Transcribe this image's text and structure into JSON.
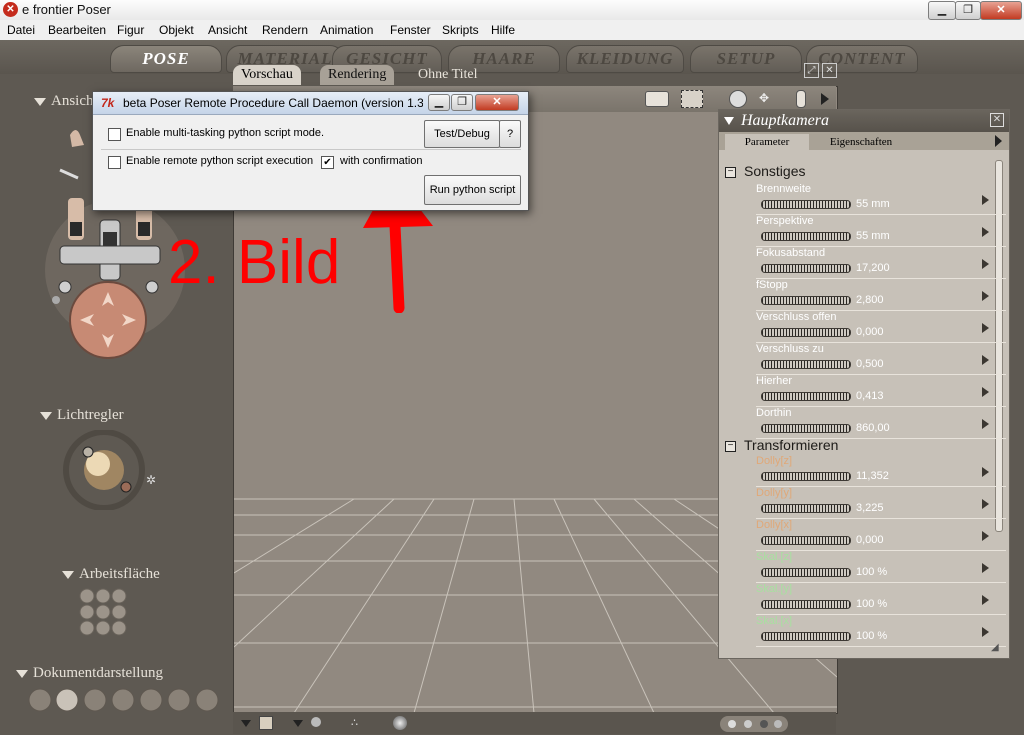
{
  "window": {
    "title": "e frontier Poser",
    "app_icon": "poser-logo-icon"
  },
  "menubar": {
    "items": [
      "Datei",
      "Bearbeiten",
      "Figur",
      "Objekt",
      "Ansicht",
      "Rendern",
      "Animation",
      "Fenster",
      "Skripts",
      "Hilfe"
    ]
  },
  "room_tabs": [
    "POSE",
    "MATERIAL",
    "GESICHT",
    "HAARE",
    "KLEIDUNG",
    "SETUP",
    "CONTENT"
  ],
  "left_panel": {
    "ansicht_label": "Ansicht",
    "lichtregler_label": "Lichtregler",
    "arbeitsflaeche_label": "Arbeitsfläche",
    "dokumentdarstellung_label": "Dokumentdarstellung"
  },
  "viewport": {
    "tabs": [
      "Vorschau",
      "Rendering"
    ],
    "doc_title": "Ohne Titel"
  },
  "dialog": {
    "title": "beta Poser Remote Procedure Call Daemon (version 1.3...",
    "cb_multitask": "Enable multi-tasking python script mode.",
    "cb_remote": "Enable remote python script execution",
    "cb_confirm": "with confirmation",
    "btn_test": "Test/Debug",
    "btn_help": "?",
    "btn_run": "Run python script",
    "check_mark": "✔"
  },
  "annotation": {
    "text": "2. Bild",
    "color": "#ff0000"
  },
  "param_panel": {
    "title": "Hauptkamera",
    "tab_parameter": "Parameter",
    "tab_eigenschaften": "Eigenschaften",
    "group_sonstiges": "Sonstiges",
    "group_transform": "Transformieren",
    "collapse_symbol": "−",
    "sonstiges": [
      {
        "name": "Brennweite",
        "value": "55 mm"
      },
      {
        "name": "Perspektive",
        "value": "55 mm"
      },
      {
        "name": "Fokusabstand",
        "value": "17,200"
      },
      {
        "name": "fStopp",
        "value": "2,800"
      },
      {
        "name": "Verschluss offen",
        "value": "0,000"
      },
      {
        "name": "Verschluss zu",
        "value": "0,500"
      },
      {
        "name": "Hierher",
        "value": "0,413"
      },
      {
        "name": "Dorthin",
        "value": "860,00"
      }
    ],
    "transform": [
      {
        "name": "Dolly[z]",
        "value": "11,352",
        "color": "#e0a878"
      },
      {
        "name": "Dolly[y]",
        "value": "3,225",
        "color": "#e0a878"
      },
      {
        "name": "Dolly[x]",
        "value": "0,000",
        "color": "#e0a878"
      },
      {
        "name": "Skal.[z]",
        "value": "100 %",
        "color": "#a8e0a0"
      },
      {
        "name": "Skal.[y]",
        "value": "100 %",
        "color": "#a8e0a0"
      },
      {
        "name": "Skal.[x]",
        "value": "100 %",
        "color": "#a8e0a0"
      }
    ]
  },
  "colors": {
    "brand_red": "#c42b1c",
    "panel_bg": "#5e5952",
    "viewport_bg": "#918980"
  }
}
